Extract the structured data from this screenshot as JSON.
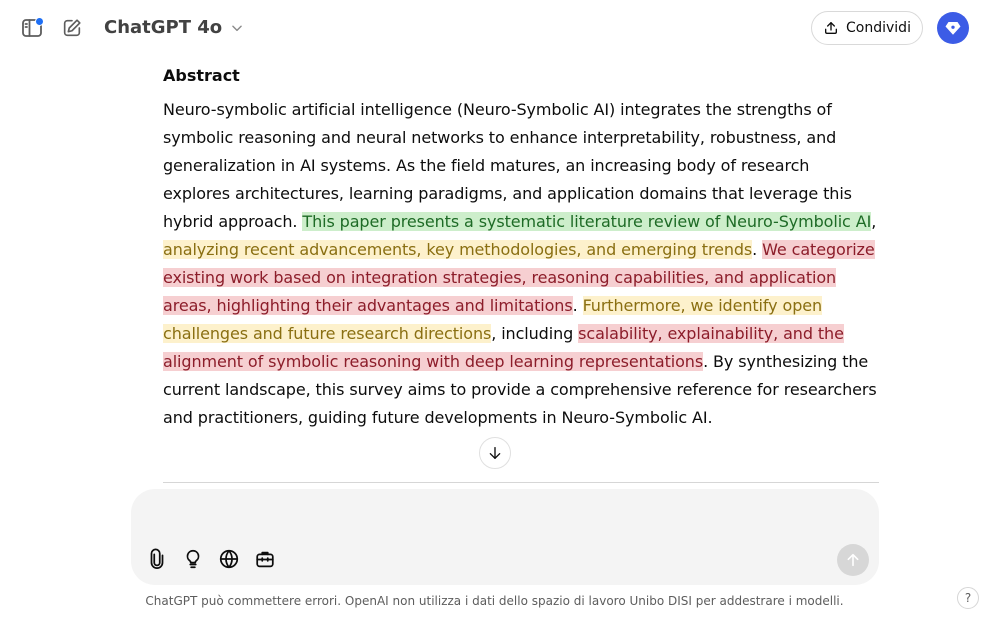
{
  "header": {
    "model_name": "ChatGPT 4o",
    "share_label": "Condividi"
  },
  "icons": {
    "sidebar": "sidebar-icon",
    "new_chat": "new-chat-icon",
    "chevron": "chevron-down-icon",
    "share": "share-icon",
    "avatar": "gem-icon",
    "scroll_down": "arrow-down-icon",
    "attach": "paperclip-icon",
    "think": "lightbulb-icon",
    "search": "globe-icon",
    "tools": "toolbox-icon",
    "send": "arrow-up-icon"
  },
  "colors": {
    "accent": "#3c5ce6",
    "notification_dot": "#1e6ff5",
    "highlight_green": "#cdeecb",
    "highlight_yellow": "#fdf1cc",
    "highlight_red": "#f6cfd1"
  },
  "message": {
    "title": "Abstract",
    "segments": {
      "s1": "Neuro-symbolic artificial intelligence (Neuro-Symbolic AI) integrates the strengths of symbolic reasoning and neural networks to enhance interpretability, robustness, and generalization in AI systems. As the field matures, an increasing body of research explores architectures, learning paradigms, and application domains that leverage this hybrid approach. ",
      "s2": "This paper presents a systematic literature review of Neuro-Symbolic AI",
      "s3": ", ",
      "s4": "analyzing recent advancements, key methodologies, and emerging trends",
      "s5": ". ",
      "s6": "We categorize existing work based on integration strategies, reasoning capabilities, and application areas, highlighting their advantages and limitations",
      "s7": ". ",
      "s8": "Furthermore, we identify open challenges and future research directions",
      "s9": ", including ",
      "s10": "scalability, explainability, and the alignment of symbolic reasoning with deep learning representations",
      "s11": ". By synthesizing the current landscape, this survey aims to provide a comprehensive reference for researchers and practitioners, guiding future developments in Neuro-Symbolic AI."
    }
  },
  "composer": {
    "placeholder": ""
  },
  "footer": {
    "disclaimer": "ChatGPT può commettere errori. OpenAI non utilizza i dati dello spazio di lavoro Unibo DISI per addestrare i modelli.",
    "help_label": "?"
  }
}
